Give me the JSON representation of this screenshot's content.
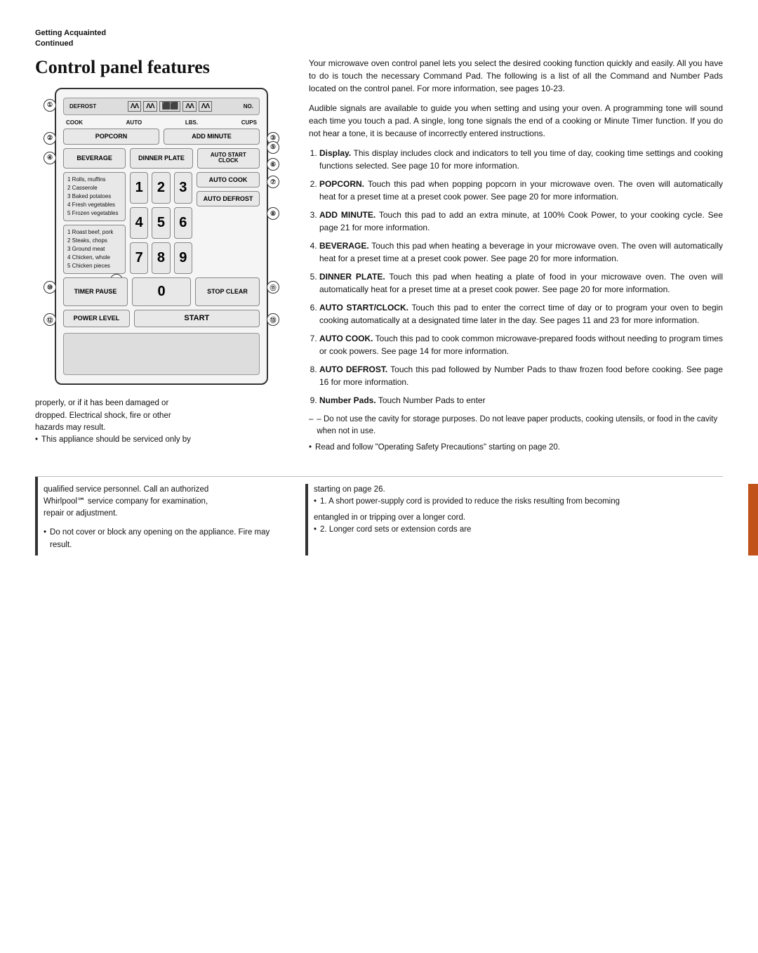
{
  "header": {
    "line1": "Getting Acquainted",
    "line2": "Continued"
  },
  "section": {
    "title": "Control panel features"
  },
  "panel": {
    "defrost_label": "DEFROST",
    "no_label": "NO.",
    "cook_label": "COOK",
    "auto_label": "AUTO",
    "lbs_label": "LBS.",
    "cups_label": "CUPS",
    "popcorn": "POPCORN",
    "add_minute": "ADD MINUTE",
    "beverage": "BEVERAGE",
    "dinner_plate": "DINNER PLATE",
    "auto_start_clock": "AUTO START CLOCK",
    "auto_cook": "AUTO COOK",
    "auto_defrost": "AUTO DEFROST",
    "timer_pause": "TIMER PAUSE",
    "stop_clear": "STOP CLEAR",
    "power_level": "POWER LEVEL",
    "start": "START",
    "zero": "0",
    "numbers": [
      "1",
      "2",
      "3",
      "4",
      "5",
      "6",
      "7",
      "8",
      "9"
    ],
    "auto_cook_list": [
      "1 Rolls, muffins",
      "2 Casserole",
      "3 Baked potatoes",
      "4 Fresh vegetables",
      "5 Frozen vegetables"
    ],
    "auto_defrost_list": [
      "1 Roast beef, pork",
      "2 Steaks, chops",
      "3 Ground meat",
      "4 Chicken, whole",
      "5 Chicken pieces"
    ],
    "callouts": [
      "①",
      "②",
      "③",
      "④",
      "⑤",
      "⑥",
      "⑦",
      "⑧",
      "⑨",
      "⑩",
      "⑪",
      "⑫",
      "⑬"
    ]
  },
  "right_text": {
    "intro": "Your microwave oven control panel lets you select the desired cooking function quickly and easily. All you have to do is touch the necessary Command Pad. The following is a list of all the Command and Number Pads located on the control panel. For more information, see pages 10-23.",
    "para2": "Audible signals are available to guide you when setting and using your oven. A programming tone will sound each time you touch a pad. A single, long tone signals the end of a cooking or Minute Timer function. If you do not hear a tone, it is because of incorrectly entered instructions.",
    "items": [
      {
        "num": "1.",
        "label": "Display.",
        "text": "This display includes clock and indicators to tell you time of day, cooking time settings and cooking functions selected. See page 10 for more information."
      },
      {
        "num": "2.",
        "label": "POPCORN.",
        "text": "Touch this pad when popping popcorn in your microwave oven. The oven will automatically heat for a preset time at a preset cook power. See page 20 for more information."
      },
      {
        "num": "3.",
        "label": "ADD MINUTE.",
        "text": "Touch this pad to add an extra minute, at 100% Cook Power, to your cooking cycle. See page 21 for more information."
      },
      {
        "num": "4.",
        "label": "BEVERAGE.",
        "text": "Touch this pad when heating a beverage in your microwave oven. The oven will automatically heat for a preset time at a preset cook power. See page 20 for more information."
      },
      {
        "num": "5.",
        "label": "DINNER PLATE.",
        "text": "Touch this pad when heating a plate of food in your microwave oven. The oven will automatically heat for a preset time at a preset cook power. See page 20 for more information."
      },
      {
        "num": "6.",
        "label": "AUTO START/CLOCK.",
        "text": "Touch this pad to enter the correct time of day or to program your oven to begin cooking automatically at a designated time later in the day. See pages 11 and 23 for more information."
      },
      {
        "num": "7.",
        "label": "AUTO COOK.",
        "text": "Touch this pad to cook common microwave-prepared foods without needing to program times or cook powers. See page 14 for more information."
      },
      {
        "num": "8.",
        "label": "AUTO DEFROST.",
        "text": "Touch this pad followed by Number Pads to thaw frozen food before cooking. See page 16 for more information."
      },
      {
        "num": "9.",
        "label": "Number Pads.",
        "text": "Touch Number Pads to enter"
      }
    ]
  },
  "bottom_warning_left": {
    "line1": "properly, or if it has been damaged or",
    "line2": "dropped. Electrical shock, fire or other",
    "line3": "hazards may result.",
    "bullet1": "This appliance should be serviced only by"
  },
  "bottom_warning_right": {
    "dash": "– Do not use the cavity for storage purposes. Do not leave paper products, cooking utensils, or food in the cavity when not in use.",
    "bullet": "Read and follow \"Operating Safety Precautions\" starting on page 20."
  },
  "bottom2_left": {
    "line1": "qualified service personnel. Call an authorized",
    "line2": "Whirlpool℠ service company for examination,",
    "line3": "repair or adjustment.",
    "bullet1": "Do not cover or block any opening on the appliance. Fire may result."
  },
  "bottom2_right": {
    "line1": "starting on page 26.",
    "bullet1": "1. A short power-supply cord is provided to reduce the risks resulting from becoming",
    "line2": "reduce the risks resulting from becoming",
    "line3": "entangled in or tripping over a longer cord.",
    "bullet2": "2. Longer cord sets or extension cords are"
  }
}
